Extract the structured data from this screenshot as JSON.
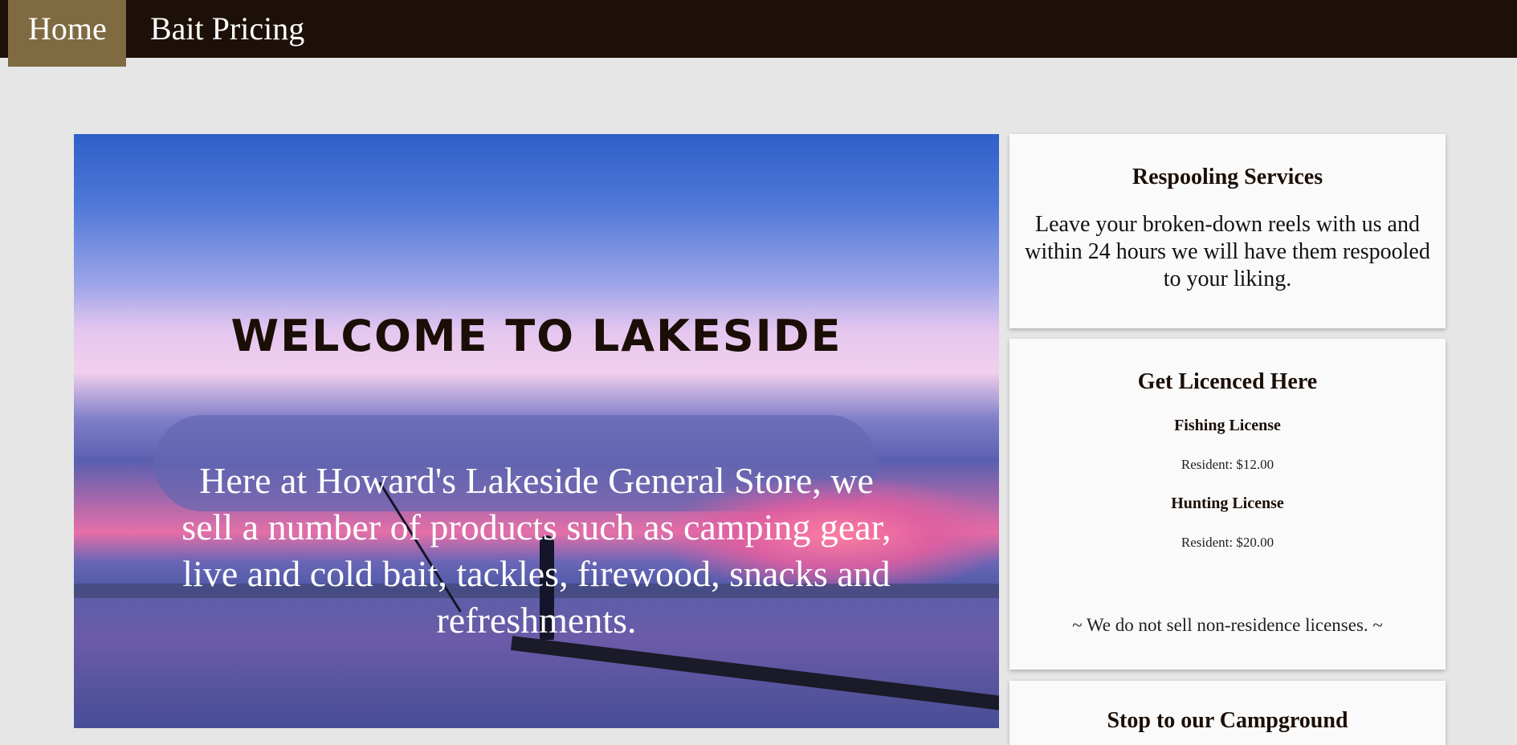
{
  "nav": {
    "items": [
      {
        "label": "Home",
        "active": true
      },
      {
        "label": "Bait Pricing",
        "active": false
      }
    ]
  },
  "hero": {
    "title": "WELCOME TO LAKESIDE",
    "text": "Here at Howard's Lakeside General Store, we sell a number of products such as camping gear, live and cold bait, tackles, firewood, snacks and refreshments."
  },
  "cards": {
    "respooling": {
      "title": "Respooling Services",
      "body": "Leave your broken-down reels with us and within 24 hours we will have them respooled to your liking."
    },
    "licences": {
      "title": "Get Licenced Here",
      "items": [
        {
          "name": "Fishing License",
          "price": "Resident: $12.00"
        },
        {
          "name": "Hunting License",
          "price": "Resident: $20.00"
        }
      ],
      "note": "~ We do not sell non-residence licenses. ~"
    },
    "third": {
      "title": "Stop to our Campground"
    }
  },
  "colors": {
    "nav_bg": "#1c1008",
    "nav_active": "#806a42",
    "page_bg": "#e6e6e6",
    "card_bg": "#fafafa",
    "title_dark": "#1a0e06"
  }
}
